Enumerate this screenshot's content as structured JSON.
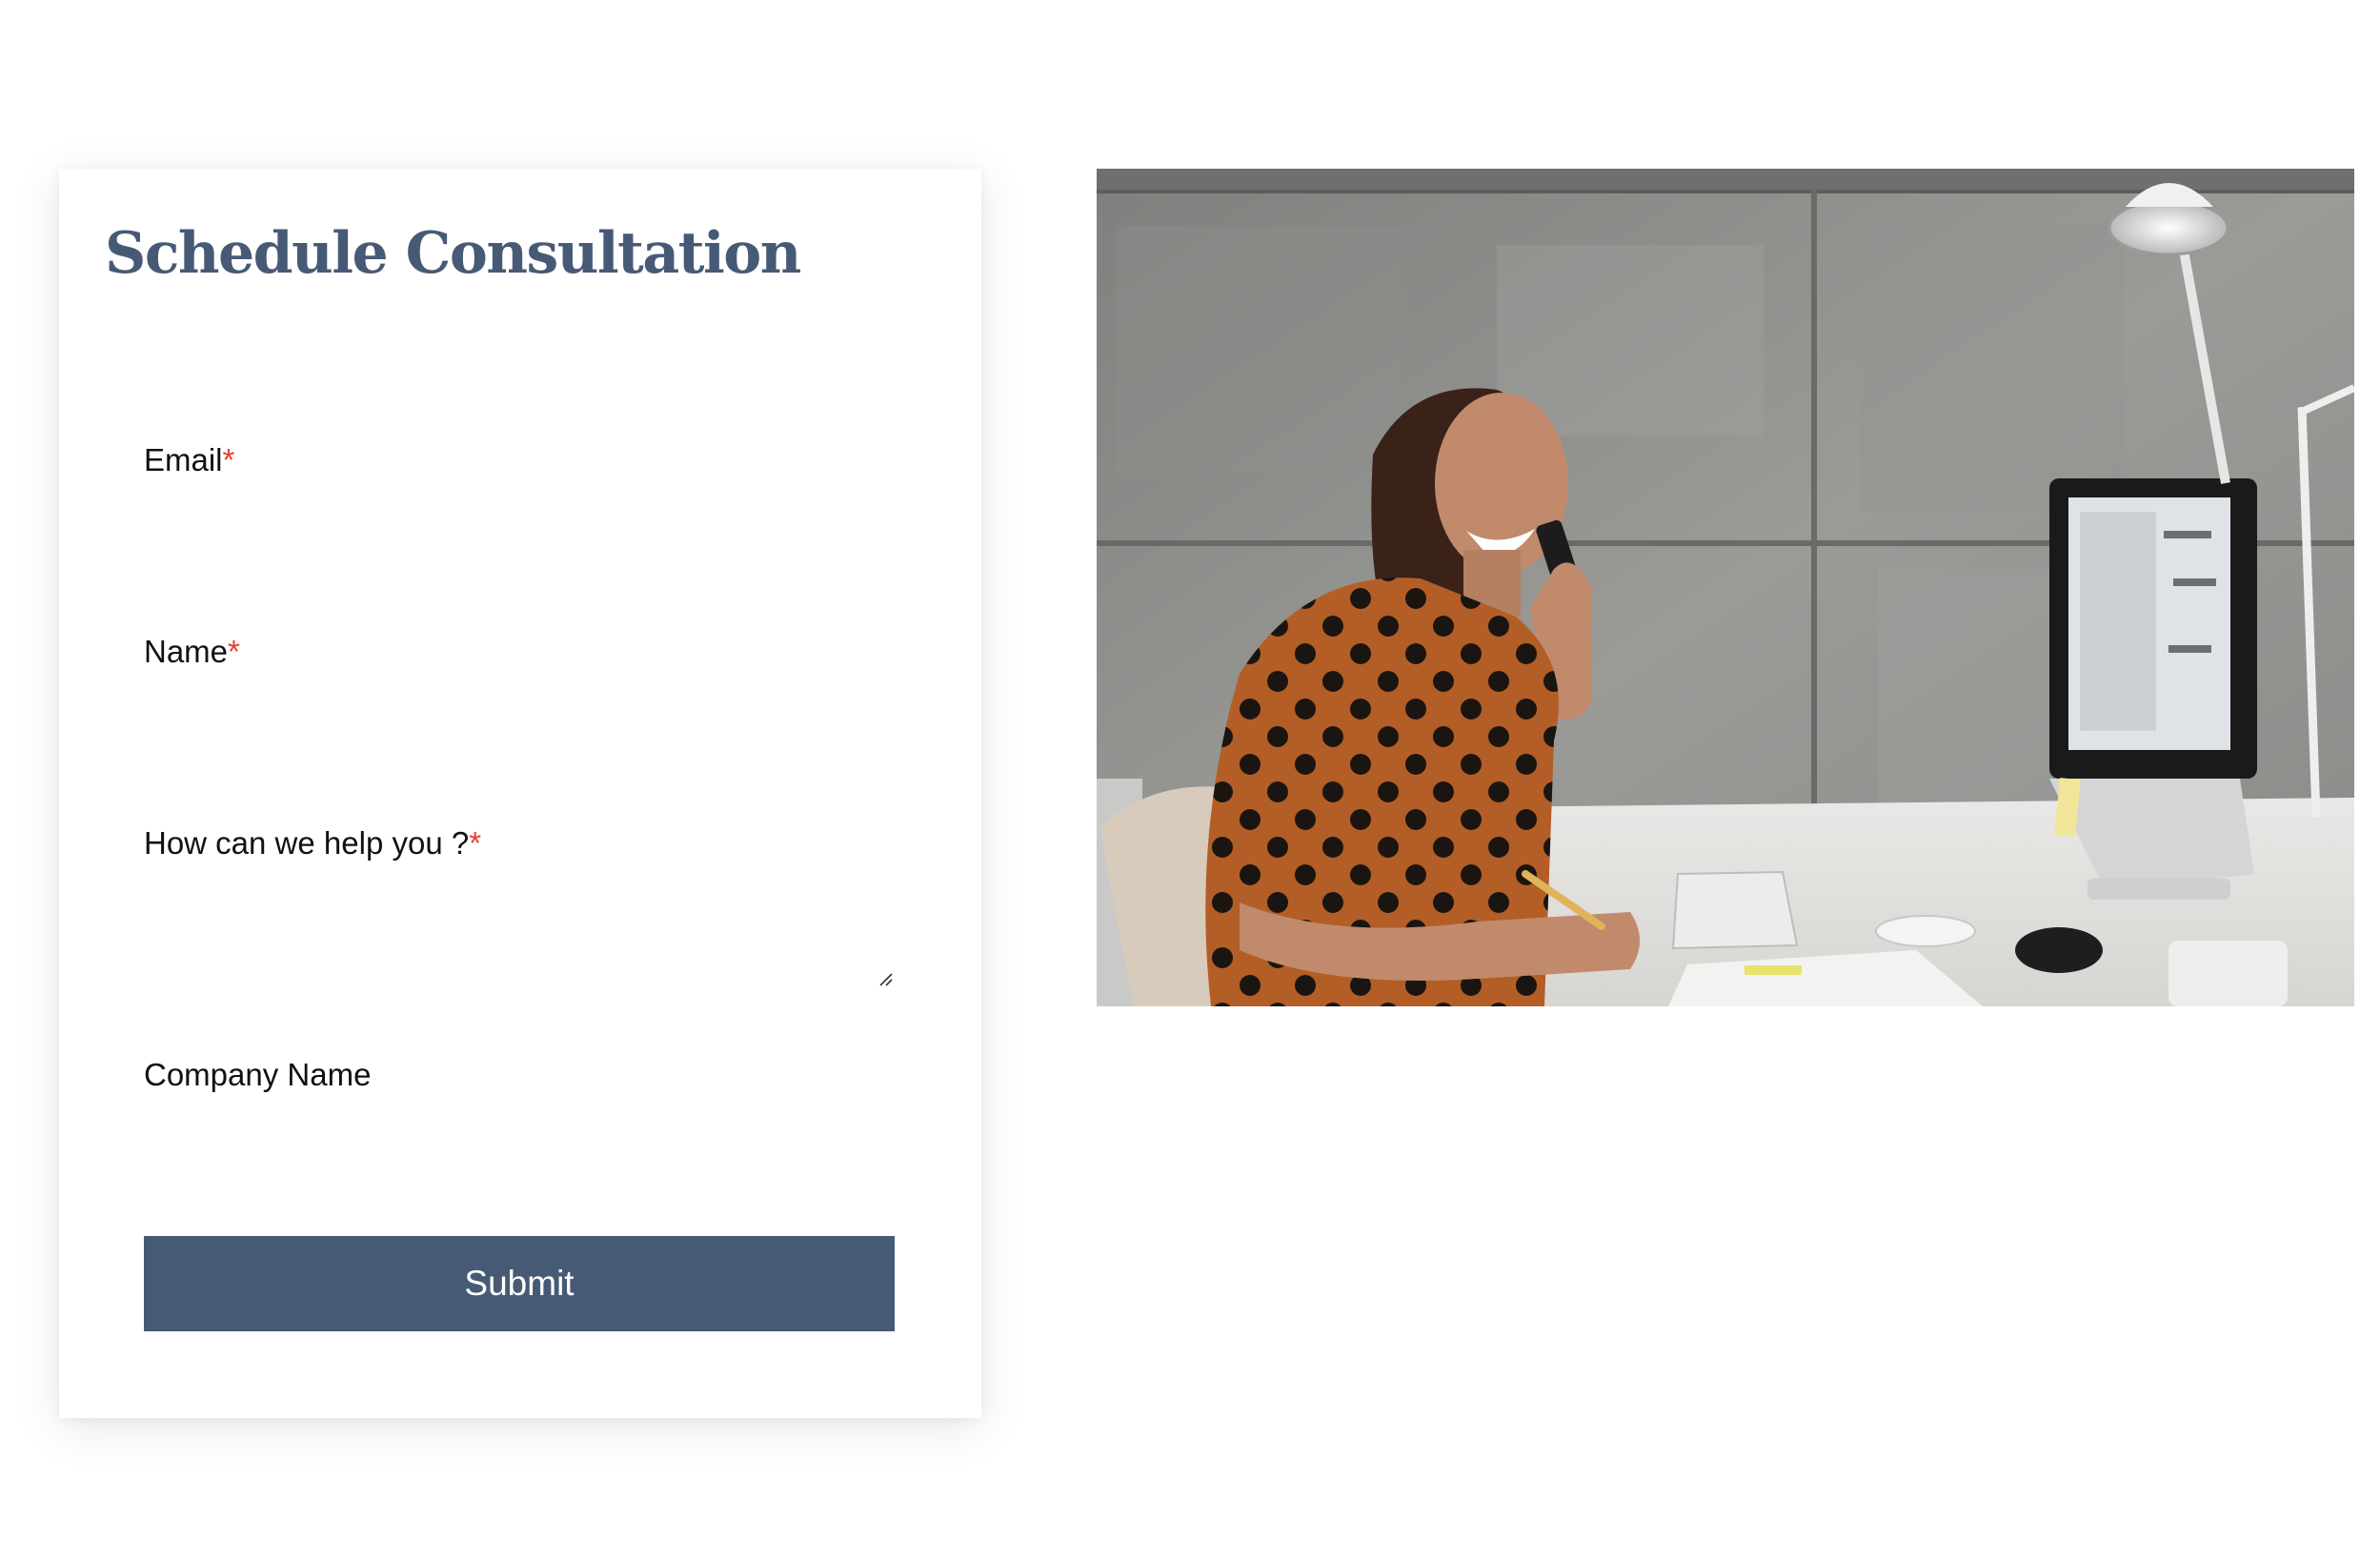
{
  "form": {
    "title": "Schedule Consultation",
    "fields": [
      {
        "label": "Email",
        "required_mark": "*",
        "value": ""
      },
      {
        "label": "Name",
        "required_mark": "*",
        "value": ""
      },
      {
        "label": "How can we help you ?",
        "required_mark": "*",
        "value": ""
      },
      {
        "label": "Company Name",
        "required_mark": "",
        "value": ""
      }
    ],
    "submit_label": "Submit"
  },
  "colors": {
    "accent": "#475a75",
    "required": "#e2412b"
  },
  "image": {
    "icon": "photo-woman-on-phone-at-desk"
  }
}
